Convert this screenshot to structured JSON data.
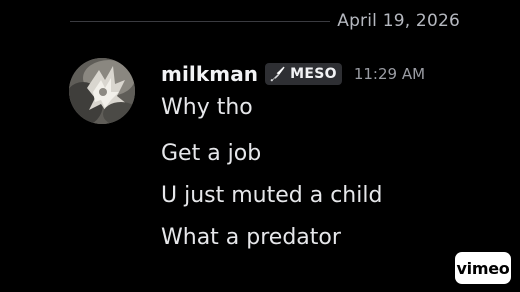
{
  "date_divider": {
    "date": "April 19, 2026"
  },
  "message_group": {
    "author": {
      "username": "milkman",
      "avatar_icon": "avatar-image",
      "role": {
        "icon": "sword-icon",
        "label": "MESO"
      }
    },
    "timestamp": "11:29 AM",
    "messages": [
      {
        "text": "Why tho"
      },
      {
        "text": "Get a job"
      },
      {
        "text": "U just muted a child"
      },
      {
        "text": "What a predator"
      }
    ]
  },
  "watermark": {
    "label": "vimeo"
  },
  "colors": {
    "background": "#000000",
    "username": "#f2f3f5",
    "message_text": "#e6e7ea",
    "timestamp": "#9a9ca3",
    "role_tag_bg": "#2e2f33",
    "watermark_bg": "#ffffff"
  }
}
